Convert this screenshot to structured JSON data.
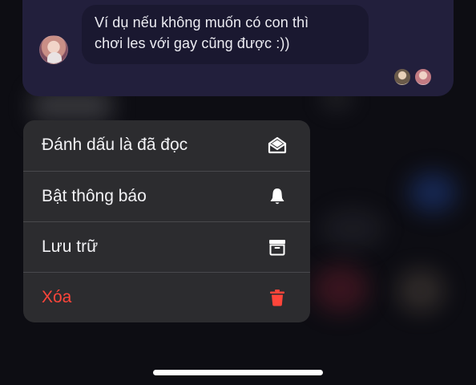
{
  "message": {
    "text_line1": "Ví dụ nếu không muốn có con thì",
    "text_line2": "chơi les với gay cũng được :))"
  },
  "context_menu": {
    "items": [
      {
        "label": "Đánh dấu là đã đọc",
        "icon": "envelope-open-icon"
      },
      {
        "label": "Bật thông báo",
        "icon": "bell-icon"
      },
      {
        "label": "Lưu trữ",
        "icon": "archive-box-icon"
      },
      {
        "label": "Xóa",
        "icon": "trash-icon"
      }
    ]
  },
  "colors": {
    "menu_background": "#2c2c2f",
    "destructive": "#ff453a",
    "chat_card": "#221f3c"
  }
}
